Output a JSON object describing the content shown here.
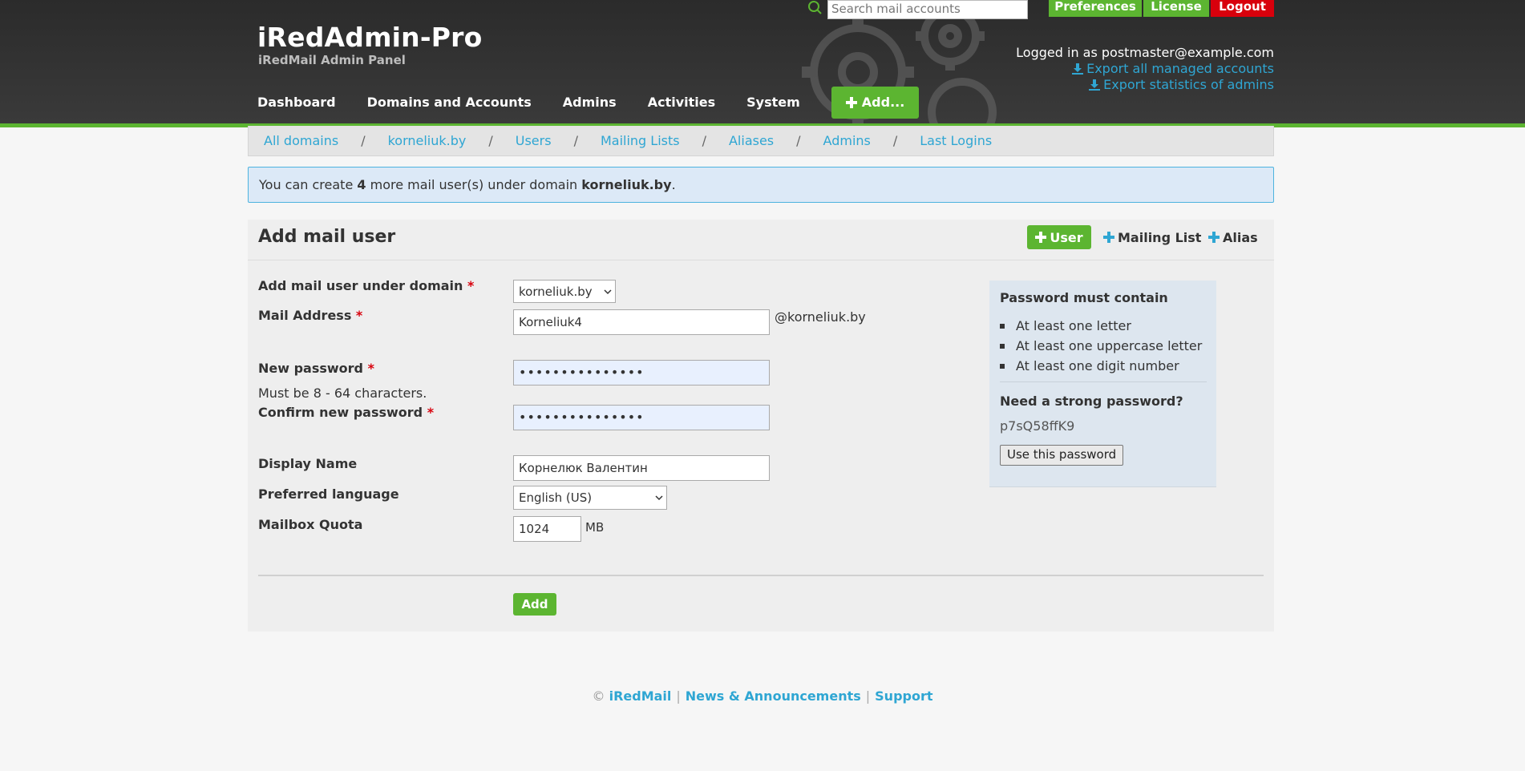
{
  "header": {
    "title": "iRedAdmin-Pro",
    "subtitle": "iRedMail Admin Panel",
    "search_placeholder": "Search mail accounts",
    "buttons": {
      "preferences": "Preferences",
      "license": "License",
      "logout": "Logout"
    },
    "logged_in": "Logged in as postmaster@example.com",
    "export_accounts": "Export all managed accounts",
    "export_stats": "Export statistics of admins",
    "nav": [
      "Dashboard",
      "Domains and Accounts",
      "Admins",
      "Activities",
      "System"
    ],
    "nav_add": "Add..."
  },
  "breadcrumb": {
    "items": [
      "All domains",
      "korneliuk.by",
      "Users",
      "Mailing Lists",
      "Aliases",
      "Admins",
      "Last Logins"
    ],
    "separator": "/"
  },
  "notice": {
    "prefix": "You can create ",
    "count": "4",
    "middle": " more mail user(s) under domain ",
    "domain": "korneliuk.by",
    "suffix": "."
  },
  "panel": {
    "title": "Add mail user",
    "tabs": {
      "user": "User",
      "mailing_list": "Mailing List",
      "alias": "Alias"
    }
  },
  "form": {
    "domain_label": "Add mail user under domain",
    "domain_value": "korneliuk.by",
    "mail_label": "Mail Address",
    "mail_value": "Korneliuk4",
    "mail_suffix": "@korneliuk.by",
    "password_label": "New password",
    "password_value": "•••••••••••••••",
    "password_hint": "Must be 8 - 64 characters.",
    "confirm_label": "Confirm new password",
    "confirm_value": "•••••••••••••••",
    "display_label": "Display Name",
    "display_value": "Корнелюк Валентин",
    "language_label": "Preferred language",
    "language_value": "English (US)",
    "quota_label": "Mailbox Quota",
    "quota_value": "1024",
    "quota_unit": "MB",
    "required_mark": "*",
    "submit": "Add"
  },
  "password_box": {
    "title": "Password must contain",
    "rules": [
      "At least one letter",
      "At least one uppercase letter",
      "At least one digit number"
    ],
    "strong_title": "Need a strong password?",
    "generated": "p7sQ58ffK9",
    "use_button": "Use this password"
  },
  "footer": {
    "copyright": "©",
    "links": [
      "iRedMail",
      "News & Announcements",
      "Support"
    ],
    "separator": "|"
  },
  "colors": {
    "green": "#5cb531",
    "red": "#d8000c",
    "link": "#2fa6d3",
    "header_bg": "#333333"
  }
}
